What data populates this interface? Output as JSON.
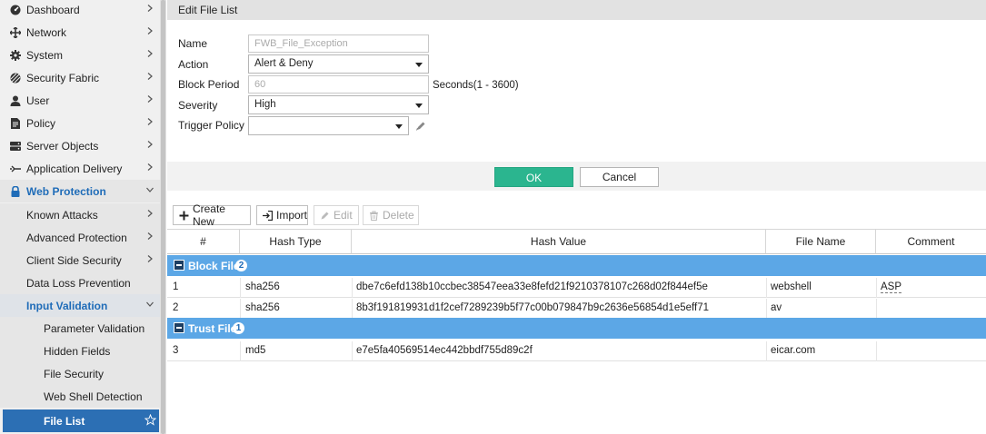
{
  "sidebar": {
    "items": [
      {
        "label": "Dashboard",
        "icon": "dashboard-icon"
      },
      {
        "label": "Network",
        "icon": "network-icon"
      },
      {
        "label": "System",
        "icon": "gear-icon"
      },
      {
        "label": "Security Fabric",
        "icon": "security-fabric-icon"
      },
      {
        "label": "User",
        "icon": "user-icon"
      },
      {
        "label": "Policy",
        "icon": "policy-icon"
      },
      {
        "label": "Server Objects",
        "icon": "server-icon"
      },
      {
        "label": "Application Delivery",
        "icon": "app-delivery-icon"
      },
      {
        "label": "Web Protection",
        "icon": "lock-icon"
      }
    ],
    "web_protection_children": [
      {
        "label": "Known Attacks"
      },
      {
        "label": "Advanced Protection"
      },
      {
        "label": "Client Side Security"
      },
      {
        "label": "Data Loss Prevention"
      },
      {
        "label": "Input Validation"
      }
    ],
    "input_validation_children": [
      {
        "label": "Parameter Validation"
      },
      {
        "label": "Hidden Fields"
      },
      {
        "label": "File Security"
      },
      {
        "label": "Web Shell Detection"
      },
      {
        "label": "File List"
      }
    ]
  },
  "page": {
    "title": "Edit File List"
  },
  "form": {
    "name_label": "Name",
    "name_value": "FWB_File_Exception",
    "action_label": "Action",
    "action_value": "Alert & Deny",
    "block_period_label": "Block Period",
    "block_period_value": "60",
    "block_period_hint": "Seconds(1 - 3600)",
    "severity_label": "Severity",
    "severity_value": "High",
    "trigger_policy_label": "Trigger Policy",
    "trigger_policy_value": ""
  },
  "buttons": {
    "ok": "OK",
    "cancel": "Cancel"
  },
  "toolbar": {
    "create_new": "Create New",
    "import": "Import",
    "edit": "Edit",
    "delete": "Delete"
  },
  "table": {
    "columns": [
      "#",
      "Hash Type",
      "Hash Value",
      "File Name",
      "Comment"
    ],
    "groups": [
      {
        "name": "Block File",
        "count": "2",
        "rows": [
          {
            "num": "1",
            "hash_type": "sha256",
            "hash_value": "dbe7c6efd138b10ccbec38547eea33e8fefd21f9210378107c268d02f844ef5e",
            "file_name": "webshell",
            "comment": "ASP"
          },
          {
            "num": "2",
            "hash_type": "sha256",
            "hash_value": "8b3f191819931d1f2cef7289239b5f77c00b079847b9c2636e56854d1e5eff71",
            "file_name": "av",
            "comment": ""
          }
        ]
      },
      {
        "name": "Trust File",
        "count": "1",
        "rows": [
          {
            "num": "3",
            "hash_type": "md5",
            "hash_value": "e7e5fa40569514ec442bbdf755d89c2f",
            "file_name": "eicar.com",
            "comment": ""
          }
        ]
      }
    ]
  },
  "colors": {
    "accent": "#2c6fb4",
    "ok_button": "#2bb58f",
    "group_row": "#5ca7e6"
  }
}
